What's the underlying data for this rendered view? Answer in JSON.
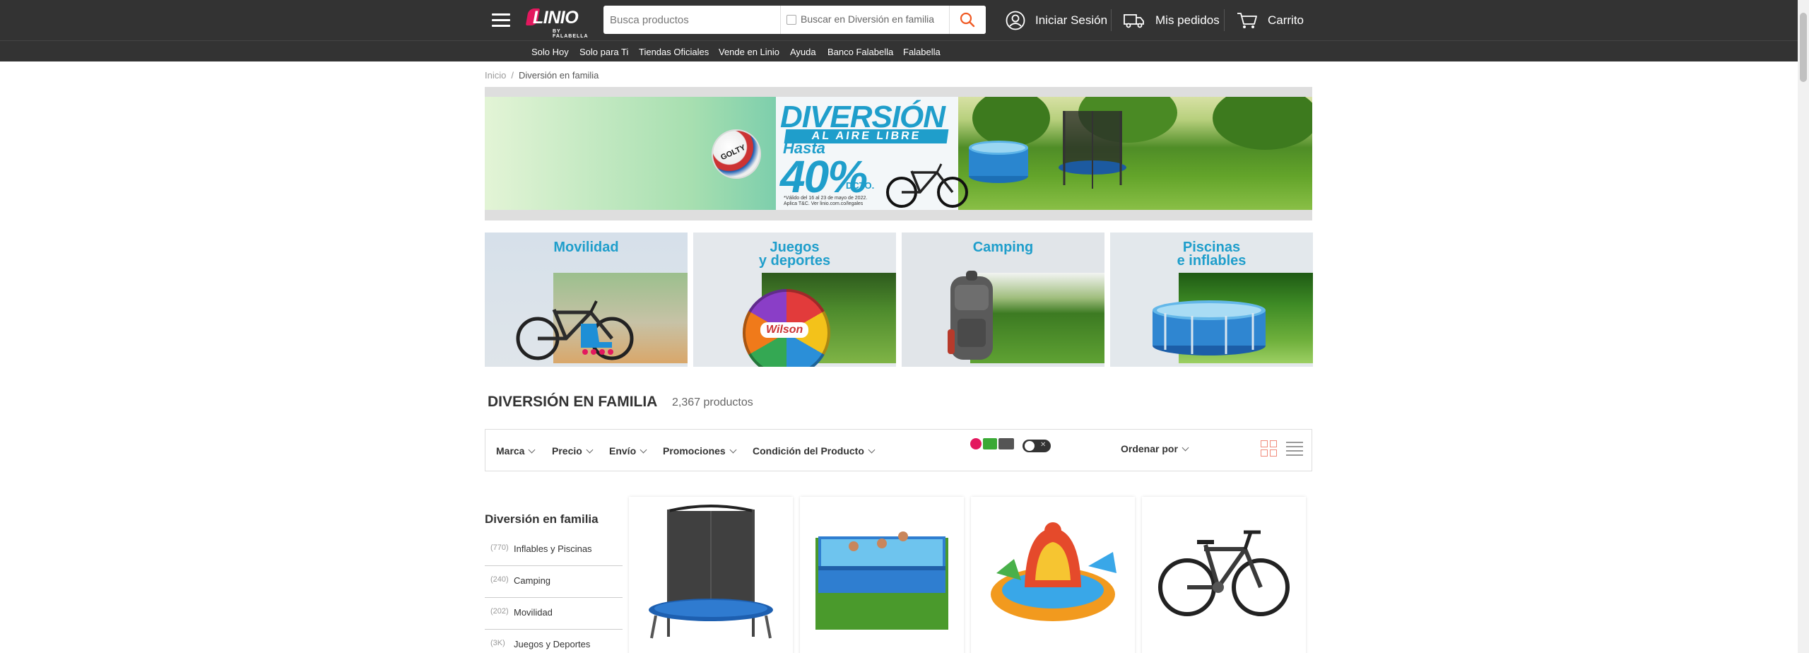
{
  "header": {
    "logo_text": "LINIO",
    "logo_sub": "BY FALABELLA",
    "search_placeholder": "Busca productos",
    "search_scope_label": "Buscar en Diversión en familia",
    "login_label": "Iniciar Sesión",
    "orders_label": "Mis pedidos",
    "cart_label": "Carrito"
  },
  "nav": {
    "links": [
      "Solo Hoy",
      "Solo para Ti",
      "Tiendas Oficiales",
      "Vende en Linio",
      "Ayuda",
      "Banco Falabella",
      "Falabella"
    ]
  },
  "breadcrumb": {
    "home": "Inicio",
    "separator": "/",
    "current": "Diversión en familia"
  },
  "hero": {
    "title": "DIVERSIÓN",
    "subtitle": "AL AIRE LIBRE",
    "hasta": "Hasta",
    "percent": "40%",
    "dcto": "DCTO.",
    "legal_1": "*Válido del 16 al 23 de mayo de 2022.",
    "legal_2": "Aplica T&C. Ver linio.com.co/legales",
    "ball_brand": "GOLTY",
    "brand_color": "#1f9ecb"
  },
  "tiles": [
    {
      "title": "Movilidad"
    },
    {
      "title": "Juegos\ny deportes",
      "ball_brand": "Wilson"
    },
    {
      "title": "Camping"
    },
    {
      "title": "Piscinas\ne inflables"
    }
  ],
  "section": {
    "title": "DIVERSIÓN EN FAMILIA",
    "count": "2,367 productos"
  },
  "filters": {
    "items": [
      "Marca",
      "Precio",
      "Envío",
      "Promociones",
      "Condición del Producto"
    ],
    "sort_label": "Ordenar por",
    "toggle_state": "off"
  },
  "sidebar": {
    "title": "Diversión en familia",
    "items": [
      {
        "count": "(770)",
        "label": "Inflables y Piscinas"
      },
      {
        "count": "(240)",
        "label": "Camping"
      },
      {
        "count": "(202)",
        "label": "Movilidad"
      },
      {
        "count": "(3K)",
        "label": "Juegos y Deportes"
      }
    ]
  },
  "products": [
    {
      "icon": "trampoline-image"
    },
    {
      "icon": "pool-image"
    },
    {
      "icon": "inflatable-playcenter-image"
    },
    {
      "icon": "bicycle-image"
    }
  ],
  "colors": {
    "header_bg": "#333333",
    "accent": "#f05a24",
    "brand_blue": "#1f9ecb"
  }
}
